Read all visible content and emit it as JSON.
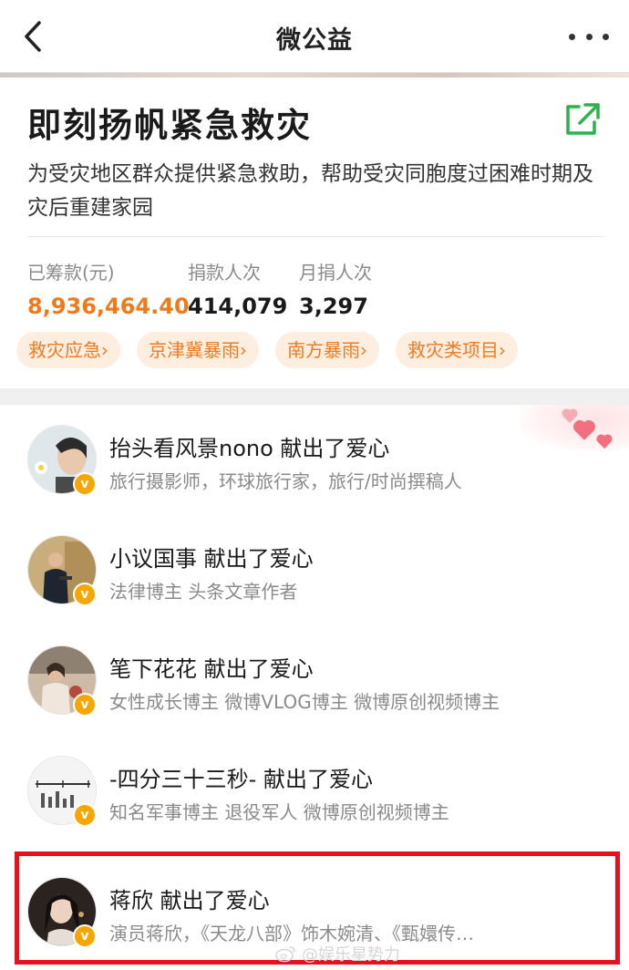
{
  "navbar": {
    "title": "微公益",
    "back_icon": "chevron-left-icon",
    "more_icon": "more-dots-icon"
  },
  "project": {
    "title": "即刻扬帆紧急救灾",
    "description": "为受灾地区群众提供紧急救助，帮助受灾同胞度过困难时期及灾后重建家园",
    "share_icon": "share-external-icon",
    "share_color": "#2bb24c",
    "stats": [
      {
        "label": "已筹款(元)",
        "value": "8,936,464.40",
        "accent": "#f07a1a"
      },
      {
        "label": "捐款人次",
        "value": "414,079"
      },
      {
        "label": "月捐人次",
        "value": "3,297"
      }
    ],
    "tags": [
      "救灾应急›",
      "京津冀暴雨›",
      "南方暴雨›",
      "救灾类项目›"
    ]
  },
  "donors": [
    {
      "name": "抬头看风景nono 献出了爱心",
      "bio": "旅行摄影师，环球旅行家，旅行/时尚撰稿人",
      "badge": "v"
    },
    {
      "name": "小议国事 献出了爱心",
      "bio": "法律博主 头条文章作者",
      "badge": "v"
    },
    {
      "name": "笔下花花 献出了爱心",
      "bio": "女性成长博主 微博VLOG博主 微博原创视频博主",
      "badge": "v"
    },
    {
      "name": "-四分三十三秒- 献出了爱心",
      "bio": "知名军事博主 退役军人 微博原创视频博主",
      "badge": "v"
    },
    {
      "name": "蒋欣 献出了爱心",
      "bio": "演员蒋欣，《天龙八部》饰木婉清、《甄嬛传…",
      "badge": "v"
    }
  ],
  "highlight_color": "#e8101c",
  "watermark": "@娱乐星势力"
}
